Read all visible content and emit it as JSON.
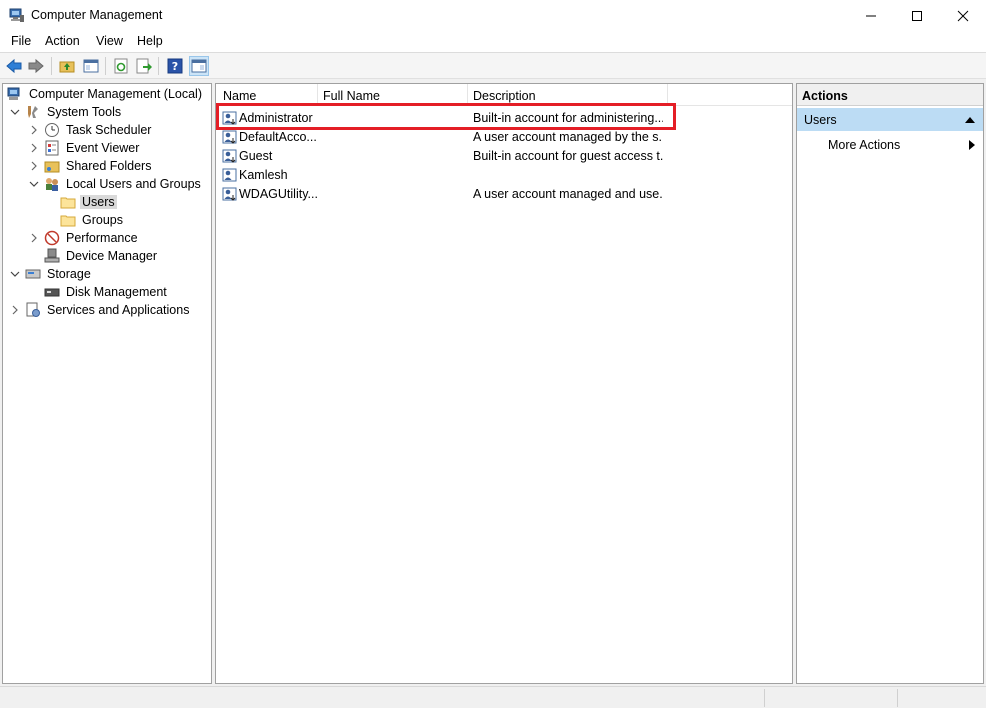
{
  "window": {
    "title": "Computer Management"
  },
  "menu": [
    "File",
    "Action",
    "View",
    "Help"
  ],
  "toolbar": [
    "back-icon",
    "forward-icon",
    "up-folder-icon",
    "show-hide-tree-icon",
    "refresh-icon",
    "export-list-icon",
    "help-icon",
    "show-hide-action-pane-icon"
  ],
  "tree": {
    "root": "Computer Management (Local)",
    "system_tools": "System Tools",
    "task_scheduler": "Task Scheduler",
    "event_viewer": "Event Viewer",
    "shared_folders": "Shared Folders",
    "local_users_groups": "Local Users and Groups",
    "users": "Users",
    "groups": "Groups",
    "performance": "Performance",
    "device_manager": "Device Manager",
    "storage": "Storage",
    "disk_management": "Disk Management",
    "services_apps": "Services and Applications"
  },
  "list": {
    "columns": [
      "Name",
      "Full Name",
      "Description"
    ],
    "rows": [
      {
        "name": "Administrator",
        "full_name": "",
        "description": "Built-in account for administering..."
      },
      {
        "name": "DefaultAcco...",
        "full_name": "",
        "description": "A user account managed by the s..."
      },
      {
        "name": "Guest",
        "full_name": "",
        "description": "Built-in account for guest access t..."
      },
      {
        "name": "Kamlesh",
        "full_name": "",
        "description": ""
      },
      {
        "name": "WDAGUtility...",
        "full_name": "",
        "description": "A user account managed and use..."
      }
    ]
  },
  "actions": {
    "title": "Actions",
    "section": "Users",
    "items": [
      "More Actions"
    ]
  },
  "colors": {
    "highlight": "#e41e26",
    "selection": "#bcdcf4"
  }
}
